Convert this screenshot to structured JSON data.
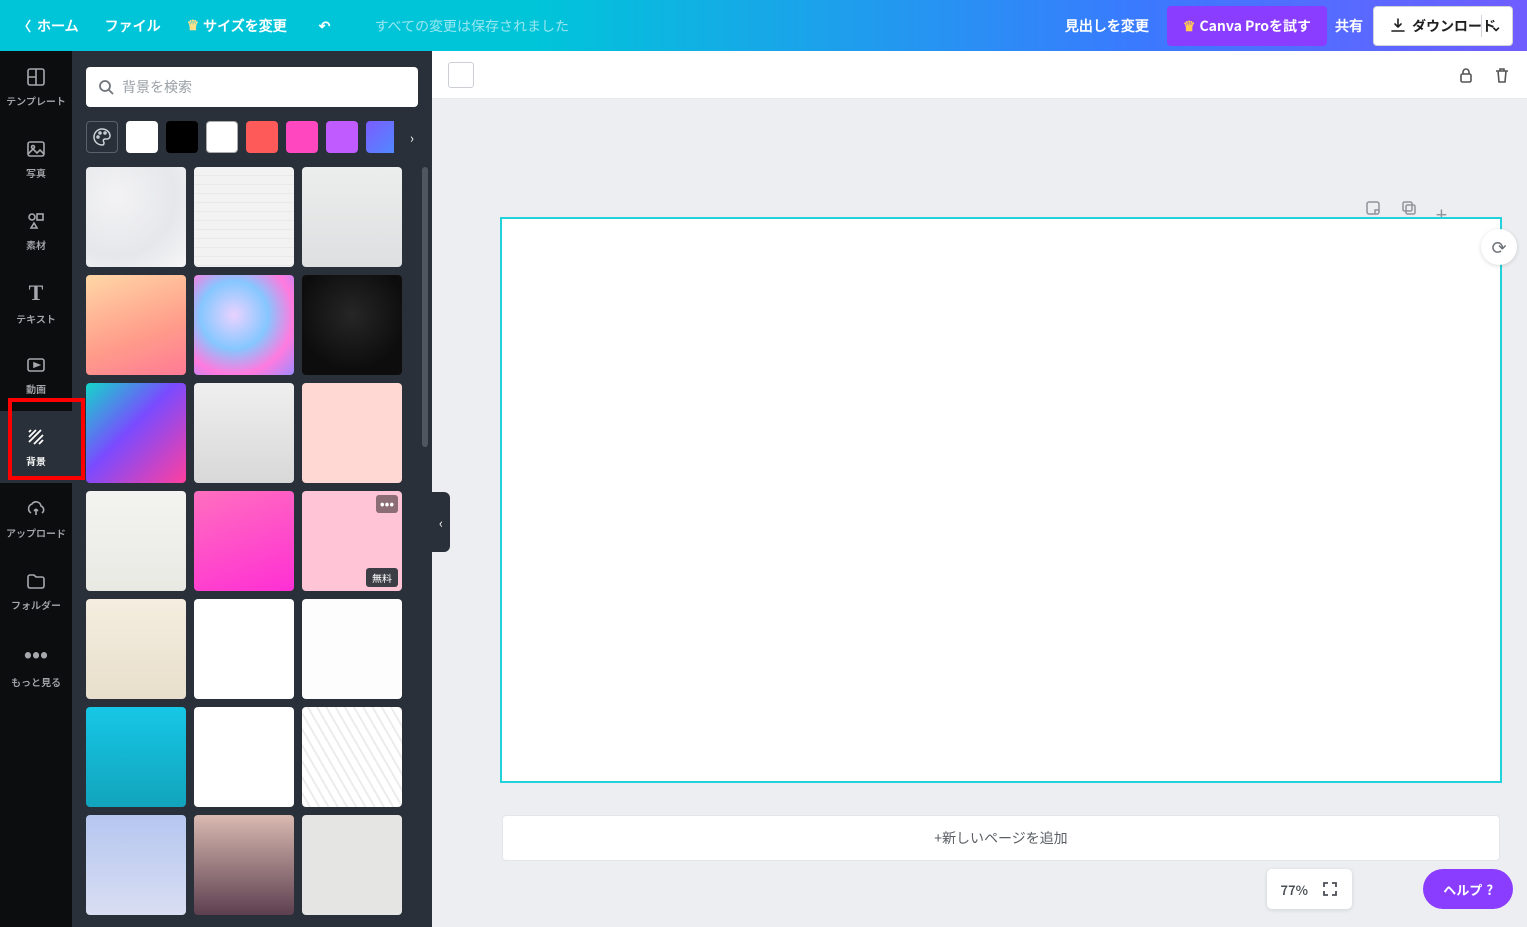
{
  "header": {
    "home": "ホーム",
    "file": "ファイル",
    "resize": "サイズを変更",
    "status": "すべての変更は保存されました",
    "change_heading": "見出しを変更",
    "try_pro": "Canva Proを試す",
    "share": "共有",
    "download": "ダウンロード"
  },
  "rail": {
    "templates": "テンプレート",
    "photos": "写真",
    "elements": "素材",
    "text": "テキスト",
    "video": "動画",
    "background": "背景",
    "upload": "アップロード",
    "folder": "フォルダー",
    "more": "もっと見る"
  },
  "panel": {
    "search_placeholder": "背景を検索",
    "swatches": [
      {
        "name": "color-picker",
        "css": "background:#293039"
      },
      {
        "name": "white",
        "css": "background:#ffffff"
      },
      {
        "name": "black",
        "css": "background:#000000"
      },
      {
        "name": "light",
        "css": "background:#ffffff;border:1px solid #aaa"
      },
      {
        "name": "red",
        "css": "background:#ff5a5a"
      },
      {
        "name": "pink",
        "css": "background:#ff47c0"
      },
      {
        "name": "violet",
        "css": "background:#c05cff"
      },
      {
        "name": "gradient",
        "css": "background:linear-gradient(135deg,#7b5cff,#4e8bff)"
      }
    ],
    "thumbs": [
      {
        "name": "marble-white",
        "style": "background:radial-gradient(circle at 30% 30%,#f3f3f5,#e6e7ea 60%,#f6f6f8)"
      },
      {
        "name": "brick-white",
        "style": "background:repeating-linear-gradient(#f2f2f2 0 8px,#e9e9e9 8px 9px)"
      },
      {
        "name": "concrete-light",
        "style": "background:linear-gradient(#eceded,#dedfe0)"
      },
      {
        "name": "peach-gradient",
        "style": "background:linear-gradient(160deg,#ffd7a6,#ff9c8a 60%,#ff7a95)"
      },
      {
        "name": "paint-swirl",
        "style": "background:radial-gradient(circle at 40% 40%,#e9d2ff,#86c7ff 40%,#ff7adf 70%,#9f8bff)"
      },
      {
        "name": "black-marble",
        "style": "background:radial-gradient(circle at 50% 40%,#262626,#0d0d0d 70%)"
      },
      {
        "name": "poly-rainbow",
        "style": "background:linear-gradient(135deg,#13d6c9,#7a4bff 45%,#ff3f9e)"
      },
      {
        "name": "crumpled-paper",
        "style": "background:linear-gradient(#efefef,#d8d8d8)"
      },
      {
        "name": "blush-pink",
        "style": "background:#ffd7d3"
      },
      {
        "name": "plaster",
        "style": "background:linear-gradient(#f3f3f0,#e9e9e4)"
      },
      {
        "name": "magenta-gradient",
        "style": "background:linear-gradient(160deg,#ff6fbf,#ff2fd4)"
      },
      {
        "name": "daisies",
        "style": "background:#ffc5d6",
        "tag": "無料",
        "dots": true
      },
      {
        "name": "sand",
        "style": "background:linear-gradient(#f4eee0,#e8decb)"
      },
      {
        "name": "floral-white",
        "style": "background:#ffffff"
      },
      {
        "name": "orange-dots",
        "style": "background:#fdfdfd"
      },
      {
        "name": "teal-paper",
        "style": "background:linear-gradient(#16c7e6,#12a4bc)"
      },
      {
        "name": "rainbow-smoke",
        "style": "background:linear-gradient(90deg,#ffffff,#ffffff)"
      },
      {
        "name": "white-waves",
        "style": "background:repeating-linear-gradient(60deg,#ffffff 0 6px,#ececec 6px 8px)"
      },
      {
        "name": "blue-sky",
        "style": "background:linear-gradient(#b5c6ef,#d9def3)"
      },
      {
        "name": "dusk",
        "style": "background:linear-gradient(#d9b9b0,#5d4050)"
      },
      {
        "name": "grey-plaster",
        "style": "background:#e5e6e3"
      }
    ]
  },
  "canvas": {
    "add_page": "+新しいページを追加"
  },
  "footer": {
    "zoom": "77%",
    "help": "ヘルプ"
  }
}
